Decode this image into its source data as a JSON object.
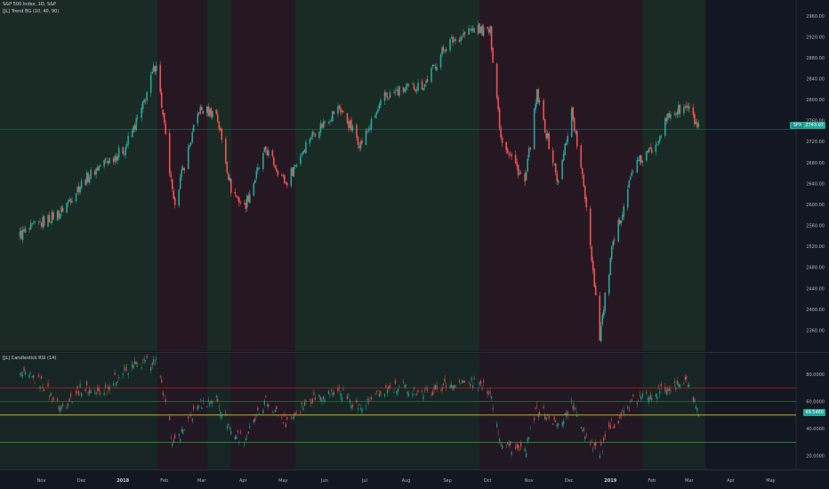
{
  "header": {
    "title": "S&P 500 Index, 1D, S&P",
    "indicator": "[JL] Trend BG (10, 40, 90)"
  },
  "rsi_panel": {
    "title": "[JL] Candlestick RSI (14)"
  },
  "current_price": {
    "symbol": "SPX",
    "value": "2743.07"
  },
  "current_rsi": {
    "value": "49.5460"
  },
  "colors": {
    "background": "#131722",
    "bull": "#26a69a",
    "bear": "#ef5350",
    "bg_up": "#1c3326",
    "bg_down": "#2e1a24",
    "overbought": "#b71c1c",
    "midline": "#e6c229",
    "oversold": "#1faa3a"
  },
  "chart_data": [
    {
      "type": "candlestick",
      "title": "S&P 500 Index, 1D, S&P",
      "ylim": [
        2320,
        2980
      ],
      "y_ticks": [
        "2960.00",
        "2920.00",
        "2880.00",
        "2840.00",
        "2800.00",
        "2760.00",
        "2720.00",
        "2680.00",
        "2640.00",
        "2600.00",
        "2560.00",
        "2520.00",
        "2480.00",
        "2440.00",
        "2400.00",
        "2360.00"
      ],
      "x_ticks": [
        "Nov",
        "Dec",
        "2018",
        "Feb",
        "Mar",
        "Apr",
        "May",
        "Jun",
        "Jul",
        "Aug",
        "Sep",
        "Oct",
        "Nov",
        "Dec",
        "2019",
        "Feb",
        "Mar",
        "Apr",
        "May"
      ],
      "series": [
        {
          "x": [
            "2017-10-15",
            "2017-11-01",
            "2017-11-15",
            "2017-12-01",
            "2017-12-15",
            "2018-01-02",
            "2018-01-15",
            "2018-01-26",
            "2018-02-08",
            "2018-02-27",
            "2018-03-12",
            "2018-03-23",
            "2018-04-02",
            "2018-04-18",
            "2018-05-03",
            "2018-05-21",
            "2018-06-12",
            "2018-06-28",
            "2018-07-16",
            "2018-07-31",
            "2018-08-15",
            "2018-08-31",
            "2018-09-20",
            "2018-10-03",
            "2018-10-11",
            "2018-10-29",
            "2018-11-07",
            "2018-11-23",
            "2018-12-03",
            "2018-12-14",
            "2018-12-24",
            "2019-01-02",
            "2019-01-18",
            "2019-02-01",
            "2019-02-15",
            "2019-02-28",
            "2019-03-08"
          ],
          "values": [
            2540,
            2565,
            2585,
            2640,
            2675,
            2705,
            2780,
            2873,
            2600,
            2780,
            2775,
            2630,
            2595,
            2705,
            2640,
            2730,
            2785,
            2715,
            2805,
            2820,
            2830,
            2905,
            2935,
            2930,
            2730,
            2640,
            2810,
            2640,
            2780,
            2600,
            2350,
            2510,
            2670,
            2705,
            2775,
            2785,
            2743
          ]
        }
      ]
    },
    {
      "type": "line",
      "title": "[JL] Candlestick RSI (14)",
      "ylim": [
        10,
        95
      ],
      "y_ticks": [
        "80.0000",
        "60.0000",
        "40.0000",
        "20.0000"
      ],
      "levels": [
        70,
        60,
        50,
        30
      ],
      "series": [
        {
          "x": [
            "2017-10-15",
            "2017-11-01",
            "2017-11-15",
            "2017-12-01",
            "2017-12-15",
            "2018-01-02",
            "2018-01-15",
            "2018-01-26",
            "2018-02-08",
            "2018-02-27",
            "2018-03-12",
            "2018-03-23",
            "2018-04-02",
            "2018-04-18",
            "2018-05-03",
            "2018-05-21",
            "2018-06-12",
            "2018-06-28",
            "2018-07-16",
            "2018-07-31",
            "2018-08-15",
            "2018-08-31",
            "2018-09-20",
            "2018-10-03",
            "2018-10-11",
            "2018-10-29",
            "2018-11-07",
            "2018-11-23",
            "2018-12-03",
            "2018-12-14",
            "2018-12-24",
            "2019-01-02",
            "2019-01-18",
            "2019-02-01",
            "2019-02-15",
            "2019-02-28",
            "2019-03-08"
          ],
          "values": [
            80,
            74,
            55,
            70,
            66,
            82,
            88,
            90,
            28,
            58,
            62,
            38,
            32,
            60,
            45,
            62,
            68,
            55,
            68,
            70,
            66,
            72,
            74,
            68,
            30,
            22,
            55,
            42,
            58,
            35,
            22,
            42,
            60,
            66,
            70,
            74,
            48
          ]
        }
      ]
    }
  ]
}
